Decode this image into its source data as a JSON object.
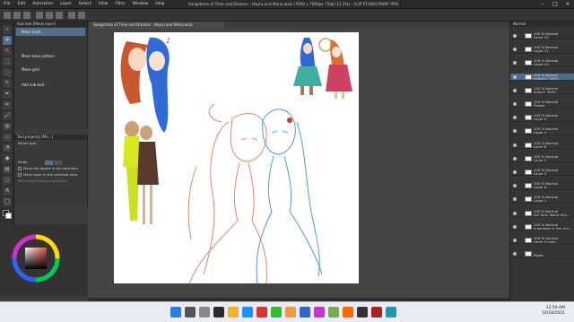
{
  "menu": [
    "File",
    "Edit",
    "Animation",
    "Layer",
    "Select",
    "View",
    "Filter",
    "Window",
    "Help"
  ],
  "window_title": "Songstress of Time and Dreams - Hayru and Mario.waiz (7000 x 7000px 72dpi 12.2%) - CLIP STUDIO PAINT PRO",
  "document_tab": "Songstress of Time and Dreams - Hayru and Mario.waiz",
  "subtool": {
    "header": "Sub tool [Move layer]",
    "items": [
      "Move layer",
      "Move tone pattern",
      "Move grid",
      "Add sub tool"
    ],
    "active_index": 0
  },
  "tool_property": {
    "header": "Tool property [Mo...]",
    "title": "Move layer",
    "mode_label": "Mode",
    "options": [
      "Move the object in the selection",
      "Move layer in the selected area",
      "Move layer/remove selection"
    ]
  },
  "layers": {
    "blend_mode": "Normal",
    "items": [
      {
        "pct": "100 % Normal",
        "name": "Layer 12",
        "sel": false
      },
      {
        "pct": "100 % Normal",
        "name": "Layer 11",
        "sel": false
      },
      {
        "pct": "100 % Normal",
        "name": "Layer 10",
        "sel": false
      },
      {
        "pct": "100 % Normal",
        "name": "index11_3293...",
        "sel": true
      },
      {
        "pct": "100 % Normal",
        "name": "index3_3293...",
        "sel": false
      },
      {
        "pct": "100 % Normal",
        "name": "Flower",
        "sel": false
      },
      {
        "pct": "100 % Normal",
        "name": "Layer 9",
        "sel": false
      },
      {
        "pct": "100 % Normal",
        "name": "Layer 4",
        "sel": false
      },
      {
        "pct": "100 % Normal",
        "name": "Layer 8",
        "sel": false
      },
      {
        "pct": "100 % Normal",
        "name": "Layer 2",
        "sel": false
      },
      {
        "pct": "100 % Normal",
        "name": "Layer 3",
        "sel": false
      },
      {
        "pct": "100 % Normal",
        "name": "Layer 6",
        "sel": false
      },
      {
        "pct": "100 % Normal",
        "name": "Layer 1",
        "sel": false
      },
      {
        "pct": "100 % Normal",
        "name": "hal_fans_blank_lhin...",
        "sel": false
      },
      {
        "pct": "100 % Normal",
        "name": "crophasig_d_lins_acc...",
        "sel": false
      },
      {
        "pct": "100 % Normal",
        "name": "Layer 5 copy",
        "sel": false
      },
      {
        "pct": "",
        "name": "Paper",
        "sel": false
      }
    ]
  },
  "clock": {
    "time": "12:59 AM",
    "date": "10/18/2021"
  },
  "colors": {
    "sketch_orange": "#e8785a",
    "sketch_blue": "#3f8fe0",
    "selected_layer": "#4d6c8c"
  }
}
